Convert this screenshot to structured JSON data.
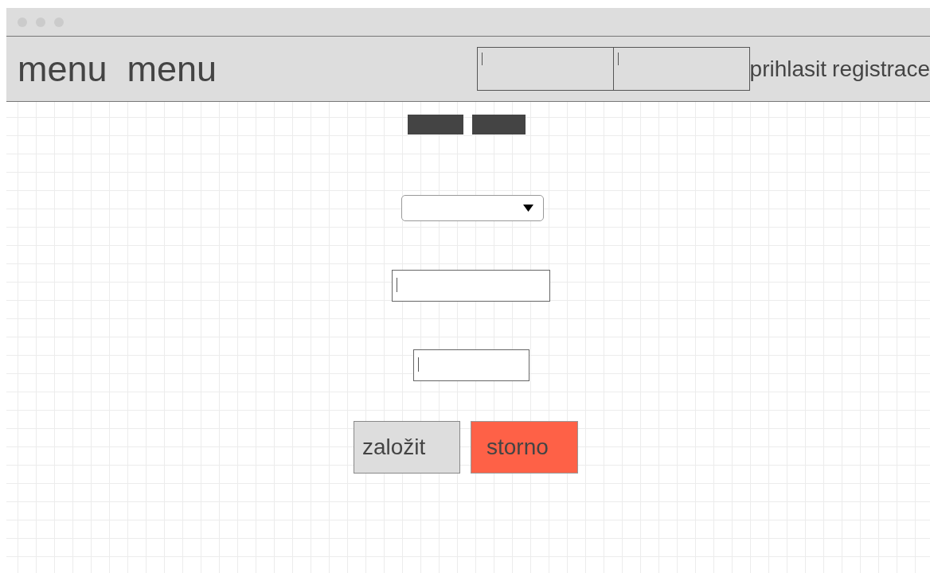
{
  "header": {
    "menu_items": [
      {
        "label": "menu"
      },
      {
        "label": "menu"
      }
    ],
    "links": [
      {
        "label": "prihlasit"
      },
      {
        "label": "registrace"
      }
    ]
  },
  "form": {
    "buttons": [
      {
        "label": "založit",
        "kind": "default"
      },
      {
        "label": "storno",
        "kind": "danger"
      }
    ]
  }
}
